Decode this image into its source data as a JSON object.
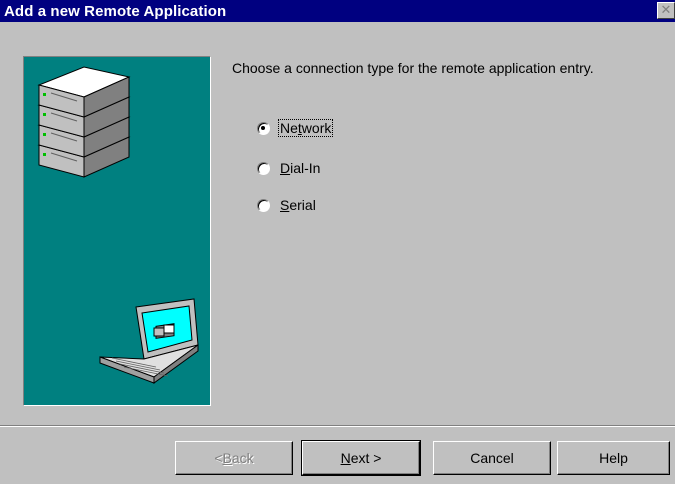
{
  "window": {
    "title": "Add a new Remote Application",
    "close_glyph": "✕"
  },
  "instruction": "Choose a connection type for the remote application entry.",
  "options": [
    {
      "pre": "Ne",
      "key": "t",
      "post": "work",
      "checked": true
    },
    {
      "pre": "",
      "key": "D",
      "post": "ial-In",
      "checked": false
    },
    {
      "pre": "",
      "key": "S",
      "post": "erial",
      "checked": false
    }
  ],
  "buttons": {
    "back": {
      "pre": "< ",
      "key": "B",
      "post": "ack",
      "enabled": false
    },
    "next": {
      "pre": "",
      "key": "N",
      "post": "ext >",
      "enabled": true
    },
    "cancel": "Cancel",
    "help": "Help"
  },
  "colors": {
    "title_bar": "#000080",
    "panel": "#008080",
    "face": "#c0c0c0"
  },
  "illustrations": [
    "server-stack-icon",
    "laptop-icon"
  ]
}
